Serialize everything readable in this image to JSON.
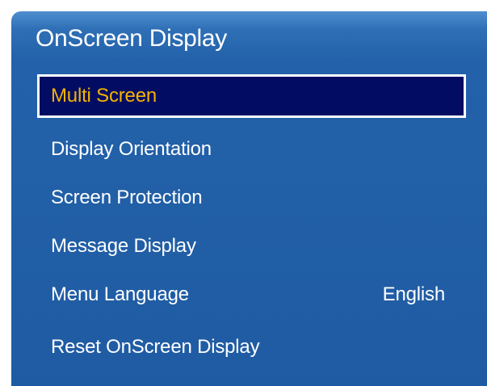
{
  "window": {
    "title": "OnScreen Display"
  },
  "menu": {
    "items": [
      {
        "label": "Multi Screen",
        "value": "",
        "selected": true
      },
      {
        "label": "Display Orientation",
        "value": ""
      },
      {
        "label": "Screen Protection",
        "value": ""
      },
      {
        "label": "Message Display",
        "value": ""
      },
      {
        "label": "Menu Language",
        "value": "English"
      },
      {
        "label": "Reset OnScreen Display",
        "value": ""
      }
    ]
  },
  "colors": {
    "panel_blue": "#2362aa",
    "selected_background": "#020c63",
    "selected_text": "#f5b300",
    "text": "#ffffff"
  }
}
